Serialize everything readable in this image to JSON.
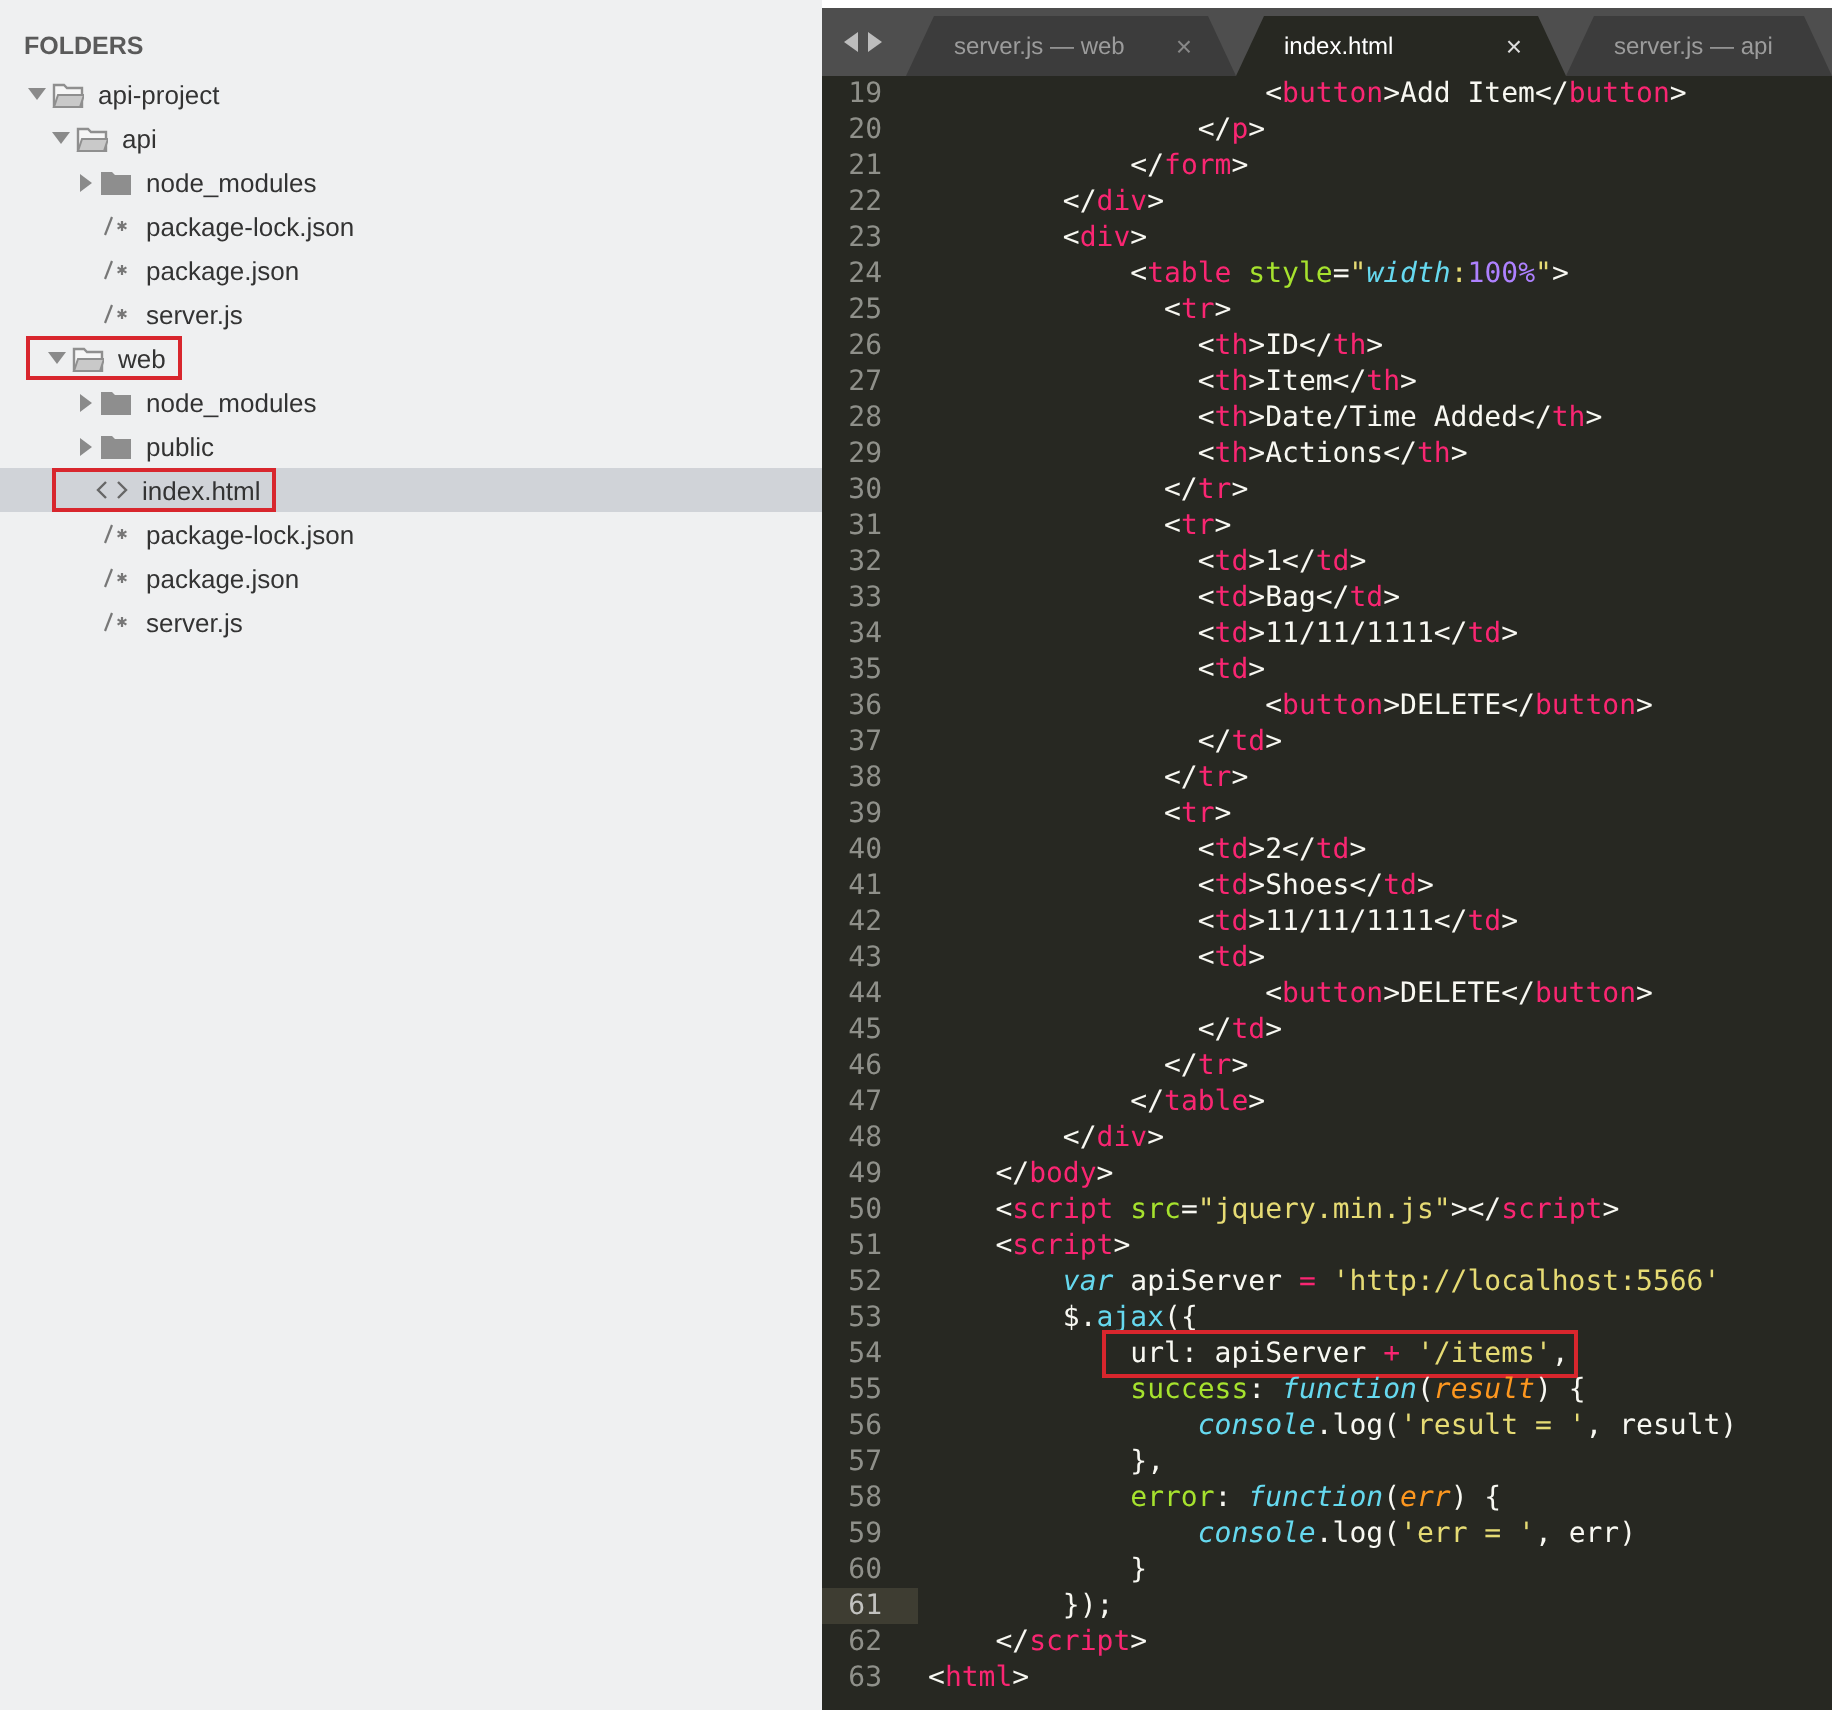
{
  "sidebar": {
    "header": "FOLDERS",
    "tree": [
      {
        "kind": "folder",
        "label": "api-project",
        "expanded": true,
        "selected": false,
        "boxed": false,
        "children": [
          {
            "kind": "folder",
            "label": "api",
            "expanded": true,
            "selected": false,
            "boxed": false,
            "children": [
              {
                "kind": "folder",
                "label": "node_modules",
                "expanded": false,
                "selected": false,
                "boxed": false
              },
              {
                "kind": "text",
                "label": "package-lock.json",
                "selected": false,
                "boxed": false
              },
              {
                "kind": "text",
                "label": "package.json",
                "selected": false,
                "boxed": false
              },
              {
                "kind": "text",
                "label": "server.js",
                "selected": false,
                "boxed": false
              }
            ]
          },
          {
            "kind": "folder",
            "label": "web",
            "expanded": true,
            "selected": false,
            "boxed": true,
            "children": [
              {
                "kind": "folder",
                "label": "node_modules",
                "expanded": false,
                "selected": false,
                "boxed": false
              },
              {
                "kind": "folder",
                "label": "public",
                "expanded": false,
                "selected": false,
                "boxed": false
              },
              {
                "kind": "code",
                "label": "index.html",
                "selected": true,
                "boxed": true
              },
              {
                "kind": "text",
                "label": "package-lock.json",
                "selected": false,
                "boxed": false
              },
              {
                "kind": "text",
                "label": "package.json",
                "selected": false,
                "boxed": false
              },
              {
                "kind": "text",
                "label": "server.js",
                "selected": false,
                "boxed": false
              }
            ]
          }
        ]
      }
    ]
  },
  "tabs": [
    {
      "label": "server.js — web",
      "selected": false,
      "close": "×"
    },
    {
      "label": "index.html",
      "selected": true,
      "close": "×"
    },
    {
      "label": "server.js — api",
      "selected": false
    }
  ],
  "editor": {
    "lines": [
      {
        "number": "19",
        "current": false,
        "boxed": false,
        "tokens": [
          {
            "kind": "punct",
            "text": "                    <"
          },
          {
            "kind": "tag",
            "text": "button"
          },
          {
            "kind": "punct",
            "text": ">Add Item</"
          },
          {
            "kind": "tag",
            "text": "button"
          },
          {
            "kind": "punct",
            "text": ">"
          }
        ]
      },
      {
        "number": "20",
        "current": false,
        "boxed": false,
        "tokens": [
          {
            "kind": "punct",
            "text": "                </"
          },
          {
            "kind": "tag",
            "text": "p"
          },
          {
            "kind": "punct",
            "text": ">"
          }
        ]
      },
      {
        "number": "21",
        "current": false,
        "boxed": false,
        "tokens": [
          {
            "kind": "punct",
            "text": "            </"
          },
          {
            "kind": "tag",
            "text": "form"
          },
          {
            "kind": "punct",
            "text": ">"
          }
        ]
      },
      {
        "number": "22",
        "current": false,
        "boxed": false,
        "tokens": [
          {
            "kind": "punct",
            "text": "        </"
          },
          {
            "kind": "tag",
            "text": "div"
          },
          {
            "kind": "punct",
            "text": ">"
          }
        ]
      },
      {
        "number": "23",
        "current": false,
        "boxed": false,
        "tokens": [
          {
            "kind": "punct",
            "text": "        <"
          },
          {
            "kind": "tag",
            "text": "div"
          },
          {
            "kind": "punct",
            "text": ">"
          }
        ]
      },
      {
        "number": "24",
        "current": false,
        "boxed": false,
        "tokens": [
          {
            "kind": "punct",
            "text": "            <"
          },
          {
            "kind": "tag",
            "text": "table"
          },
          {
            "kind": "attr",
            "text": " style"
          },
          {
            "kind": "punct",
            "text": "="
          },
          {
            "kind": "string",
            "text": "\""
          },
          {
            "kind": "support",
            "text": "width"
          },
          {
            "kind": "string",
            "text": ":"
          },
          {
            "kind": "number",
            "text": "100%"
          },
          {
            "kind": "string",
            "text": "\""
          },
          {
            "kind": "punct",
            "text": ">"
          }
        ]
      },
      {
        "number": "25",
        "current": false,
        "boxed": false,
        "tokens": [
          {
            "kind": "punct",
            "text": "              <"
          },
          {
            "kind": "tag",
            "text": "tr"
          },
          {
            "kind": "punct",
            "text": ">"
          }
        ]
      },
      {
        "number": "26",
        "current": false,
        "boxed": false,
        "tokens": [
          {
            "kind": "punct",
            "text": "                <"
          },
          {
            "kind": "tag",
            "text": "th"
          },
          {
            "kind": "punct",
            "text": ">ID</"
          },
          {
            "kind": "tag",
            "text": "th"
          },
          {
            "kind": "punct",
            "text": ">"
          }
        ]
      },
      {
        "number": "27",
        "current": false,
        "boxed": false,
        "tokens": [
          {
            "kind": "punct",
            "text": "                <"
          },
          {
            "kind": "tag",
            "text": "th"
          },
          {
            "kind": "punct",
            "text": ">Item</"
          },
          {
            "kind": "tag",
            "text": "th"
          },
          {
            "kind": "punct",
            "text": ">"
          }
        ]
      },
      {
        "number": "28",
        "current": false,
        "boxed": false,
        "tokens": [
          {
            "kind": "punct",
            "text": "                <"
          },
          {
            "kind": "tag",
            "text": "th"
          },
          {
            "kind": "punct",
            "text": ">Date/Time Added</"
          },
          {
            "kind": "tag",
            "text": "th"
          },
          {
            "kind": "punct",
            "text": ">"
          }
        ]
      },
      {
        "number": "29",
        "current": false,
        "boxed": false,
        "tokens": [
          {
            "kind": "punct",
            "text": "                <"
          },
          {
            "kind": "tag",
            "text": "th"
          },
          {
            "kind": "punct",
            "text": ">Actions</"
          },
          {
            "kind": "tag",
            "text": "th"
          },
          {
            "kind": "punct",
            "text": ">"
          }
        ]
      },
      {
        "number": "30",
        "current": false,
        "boxed": false,
        "tokens": [
          {
            "kind": "punct",
            "text": "              </"
          },
          {
            "kind": "tag",
            "text": "tr"
          },
          {
            "kind": "punct",
            "text": ">"
          }
        ]
      },
      {
        "number": "31",
        "current": false,
        "boxed": false,
        "tokens": [
          {
            "kind": "punct",
            "text": "              <"
          },
          {
            "kind": "tag",
            "text": "tr"
          },
          {
            "kind": "punct",
            "text": ">"
          }
        ]
      },
      {
        "number": "32",
        "current": false,
        "boxed": false,
        "tokens": [
          {
            "kind": "punct",
            "text": "                <"
          },
          {
            "kind": "tag",
            "text": "td"
          },
          {
            "kind": "punct",
            "text": ">1</"
          },
          {
            "kind": "tag",
            "text": "td"
          },
          {
            "kind": "punct",
            "text": ">"
          }
        ]
      },
      {
        "number": "33",
        "current": false,
        "boxed": false,
        "tokens": [
          {
            "kind": "punct",
            "text": "                <"
          },
          {
            "kind": "tag",
            "text": "td"
          },
          {
            "kind": "punct",
            "text": ">Bag</"
          },
          {
            "kind": "tag",
            "text": "td"
          },
          {
            "kind": "punct",
            "text": ">"
          }
        ]
      },
      {
        "number": "34",
        "current": false,
        "boxed": false,
        "tokens": [
          {
            "kind": "punct",
            "text": "                <"
          },
          {
            "kind": "tag",
            "text": "td"
          },
          {
            "kind": "punct",
            "text": ">11/11/1111</"
          },
          {
            "kind": "tag",
            "text": "td"
          },
          {
            "kind": "punct",
            "text": ">"
          }
        ]
      },
      {
        "number": "35",
        "current": false,
        "boxed": false,
        "tokens": [
          {
            "kind": "punct",
            "text": "                <"
          },
          {
            "kind": "tag",
            "text": "td"
          },
          {
            "kind": "punct",
            "text": ">"
          }
        ]
      },
      {
        "number": "36",
        "current": false,
        "boxed": false,
        "tokens": [
          {
            "kind": "punct",
            "text": "                    <"
          },
          {
            "kind": "tag",
            "text": "button"
          },
          {
            "kind": "punct",
            "text": ">DELETE</"
          },
          {
            "kind": "tag",
            "text": "button"
          },
          {
            "kind": "punct",
            "text": ">"
          }
        ]
      },
      {
        "number": "37",
        "current": false,
        "boxed": false,
        "tokens": [
          {
            "kind": "punct",
            "text": "                </"
          },
          {
            "kind": "tag",
            "text": "td"
          },
          {
            "kind": "punct",
            "text": ">"
          }
        ]
      },
      {
        "number": "38",
        "current": false,
        "boxed": false,
        "tokens": [
          {
            "kind": "punct",
            "text": "              </"
          },
          {
            "kind": "tag",
            "text": "tr"
          },
          {
            "kind": "punct",
            "text": ">"
          }
        ]
      },
      {
        "number": "39",
        "current": false,
        "boxed": false,
        "tokens": [
          {
            "kind": "punct",
            "text": "              <"
          },
          {
            "kind": "tag",
            "text": "tr"
          },
          {
            "kind": "punct",
            "text": ">"
          }
        ]
      },
      {
        "number": "40",
        "current": false,
        "boxed": false,
        "tokens": [
          {
            "kind": "punct",
            "text": "                <"
          },
          {
            "kind": "tag",
            "text": "td"
          },
          {
            "kind": "punct",
            "text": ">2</"
          },
          {
            "kind": "tag",
            "text": "td"
          },
          {
            "kind": "punct",
            "text": ">"
          }
        ]
      },
      {
        "number": "41",
        "current": false,
        "boxed": false,
        "tokens": [
          {
            "kind": "punct",
            "text": "                <"
          },
          {
            "kind": "tag",
            "text": "td"
          },
          {
            "kind": "punct",
            "text": ">Shoes</"
          },
          {
            "kind": "tag",
            "text": "td"
          },
          {
            "kind": "punct",
            "text": ">"
          }
        ]
      },
      {
        "number": "42",
        "current": false,
        "boxed": false,
        "tokens": [
          {
            "kind": "punct",
            "text": "                <"
          },
          {
            "kind": "tag",
            "text": "td"
          },
          {
            "kind": "punct",
            "text": ">11/11/1111</"
          },
          {
            "kind": "tag",
            "text": "td"
          },
          {
            "kind": "punct",
            "text": ">"
          }
        ]
      },
      {
        "number": "43",
        "current": false,
        "boxed": false,
        "tokens": [
          {
            "kind": "punct",
            "text": "                <"
          },
          {
            "kind": "tag",
            "text": "td"
          },
          {
            "kind": "punct",
            "text": ">"
          }
        ]
      },
      {
        "number": "44",
        "current": false,
        "boxed": false,
        "tokens": [
          {
            "kind": "punct",
            "text": "                    <"
          },
          {
            "kind": "tag",
            "text": "button"
          },
          {
            "kind": "punct",
            "text": ">DELETE</"
          },
          {
            "kind": "tag",
            "text": "button"
          },
          {
            "kind": "punct",
            "text": ">"
          }
        ]
      },
      {
        "number": "45",
        "current": false,
        "boxed": false,
        "tokens": [
          {
            "kind": "punct",
            "text": "                </"
          },
          {
            "kind": "tag",
            "text": "td"
          },
          {
            "kind": "punct",
            "text": ">"
          }
        ]
      },
      {
        "number": "46",
        "current": false,
        "boxed": false,
        "tokens": [
          {
            "kind": "punct",
            "text": "              </"
          },
          {
            "kind": "tag",
            "text": "tr"
          },
          {
            "kind": "punct",
            "text": ">"
          }
        ]
      },
      {
        "number": "47",
        "current": false,
        "boxed": false,
        "tokens": [
          {
            "kind": "punct",
            "text": "            </"
          },
          {
            "kind": "tag",
            "text": "table"
          },
          {
            "kind": "punct",
            "text": ">"
          }
        ]
      },
      {
        "number": "48",
        "current": false,
        "boxed": false,
        "tokens": [
          {
            "kind": "punct",
            "text": "        </"
          },
          {
            "kind": "tag",
            "text": "div"
          },
          {
            "kind": "punct",
            "text": ">"
          }
        ]
      },
      {
        "number": "49",
        "current": false,
        "boxed": false,
        "tokens": [
          {
            "kind": "punct",
            "text": "    </"
          },
          {
            "kind": "tag",
            "text": "body"
          },
          {
            "kind": "punct",
            "text": ">"
          }
        ]
      },
      {
        "number": "50",
        "current": false,
        "boxed": false,
        "tokens": [
          {
            "kind": "punct",
            "text": "    <"
          },
          {
            "kind": "tag",
            "text": "script"
          },
          {
            "kind": "attr",
            "text": " src"
          },
          {
            "kind": "punct",
            "text": "="
          },
          {
            "kind": "string",
            "text": "\"jquery.min.js\""
          },
          {
            "kind": "punct",
            "text": "></"
          },
          {
            "kind": "tag",
            "text": "script"
          },
          {
            "kind": "punct",
            "text": ">"
          }
        ]
      },
      {
        "number": "51",
        "current": false,
        "boxed": false,
        "tokens": [
          {
            "kind": "punct",
            "text": "    <"
          },
          {
            "kind": "tag",
            "text": "script"
          },
          {
            "kind": "punct",
            "text": ">"
          }
        ]
      },
      {
        "number": "52",
        "current": false,
        "boxed": false,
        "tokens": [
          {
            "kind": "storage",
            "text": "        var"
          },
          {
            "kind": "punct",
            "text": " apiServer "
          },
          {
            "kind": "operator",
            "text": "="
          },
          {
            "kind": "string",
            "text": " 'http://localhost:5566'"
          }
        ]
      },
      {
        "number": "53",
        "current": false,
        "boxed": false,
        "tokens": [
          {
            "kind": "punct",
            "text": "        $."
          },
          {
            "kind": "function",
            "text": "ajax"
          },
          {
            "kind": "punct",
            "text": "({"
          }
        ]
      },
      {
        "number": "54",
        "current": false,
        "boxed": true,
        "tokens": [
          {
            "kind": "punct",
            "text": "            url: apiServer "
          },
          {
            "kind": "operator",
            "text": "+"
          },
          {
            "kind": "string",
            "text": " '/items'"
          },
          {
            "kind": "punct",
            "text": ","
          }
        ]
      },
      {
        "number": "55",
        "current": false,
        "boxed": false,
        "tokens": [
          {
            "kind": "property",
            "text": "            success"
          },
          {
            "kind": "punct",
            "text": ": "
          },
          {
            "kind": "storage",
            "text": "function"
          },
          {
            "kind": "punct",
            "text": "("
          },
          {
            "kind": "param",
            "text": "result"
          },
          {
            "kind": "punct",
            "text": ") {"
          }
        ]
      },
      {
        "number": "56",
        "current": false,
        "boxed": false,
        "tokens": [
          {
            "kind": "support",
            "text": "                console"
          },
          {
            "kind": "punct",
            "text": ".log("
          },
          {
            "kind": "string",
            "text": "'result = '"
          },
          {
            "kind": "punct",
            "text": ", result)"
          }
        ]
      },
      {
        "number": "57",
        "current": false,
        "boxed": false,
        "tokens": [
          {
            "kind": "punct",
            "text": "            },"
          }
        ]
      },
      {
        "number": "58",
        "current": false,
        "boxed": false,
        "tokens": [
          {
            "kind": "property",
            "text": "            error"
          },
          {
            "kind": "punct",
            "text": ": "
          },
          {
            "kind": "storage",
            "text": "function"
          },
          {
            "kind": "punct",
            "text": "("
          },
          {
            "kind": "param",
            "text": "err"
          },
          {
            "kind": "punct",
            "text": ") {"
          }
        ]
      },
      {
        "number": "59",
        "current": false,
        "boxed": false,
        "tokens": [
          {
            "kind": "support",
            "text": "                console"
          },
          {
            "kind": "punct",
            "text": ".log("
          },
          {
            "kind": "string",
            "text": "'err = '"
          },
          {
            "kind": "punct",
            "text": ", err)"
          }
        ]
      },
      {
        "number": "60",
        "current": false,
        "boxed": false,
        "tokens": [
          {
            "kind": "punct",
            "text": "            }"
          }
        ]
      },
      {
        "number": "61",
        "current": true,
        "boxed": false,
        "tokens": [
          {
            "kind": "punct",
            "text": "        });"
          }
        ]
      },
      {
        "number": "62",
        "current": false,
        "boxed": false,
        "tokens": [
          {
            "kind": "punct",
            "text": "    </"
          },
          {
            "kind": "tag",
            "text": "script"
          },
          {
            "kind": "punct",
            "text": ">"
          }
        ]
      },
      {
        "number": "63",
        "current": false,
        "boxed": false,
        "tokens": [
          {
            "kind": "punct",
            "text": "<"
          },
          {
            "kind": "tag",
            "text": "html"
          },
          {
            "kind": "punct",
            "text": ">"
          }
        ]
      }
    ]
  }
}
